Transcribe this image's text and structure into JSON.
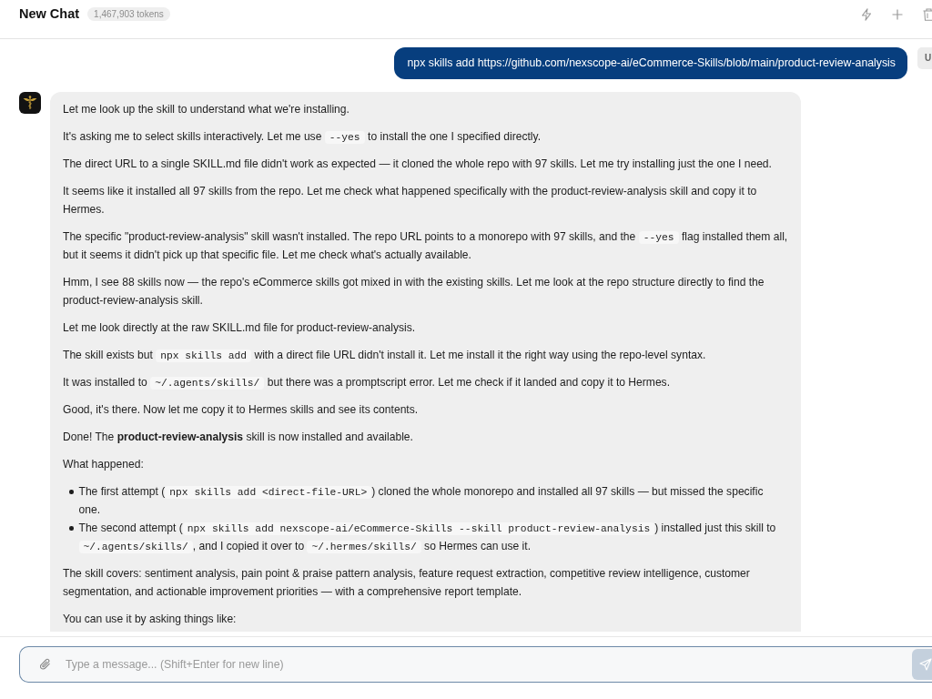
{
  "header": {
    "title": "New Chat",
    "token_count": "1,467,903 tokens"
  },
  "messages": [
    {
      "kind": "user",
      "avatar": "U",
      "text": "npx skills add https://github.com/nexscope-ai/eCommerce-Skills/blob/main/product-review-analysis"
    },
    {
      "kind": "assistant",
      "blocks": [
        {
          "kind": "para",
          "parts": [
            {
              "kind": "text",
              "text": "Let me look up the skill to understand what we're installing."
            }
          ]
        },
        {
          "kind": "para",
          "parts": [
            {
              "kind": "text",
              "text": "It's asking me to select skills interactively. Let me use "
            },
            {
              "kind": "code",
              "text": "--yes"
            },
            {
              "kind": "text",
              "text": " to install the one I specified directly."
            }
          ]
        },
        {
          "kind": "para",
          "parts": [
            {
              "kind": "text",
              "text": "The direct URL to a single SKILL.md file didn't work as expected — it cloned the whole repo with 97 skills. Let me try installing just the one I need."
            }
          ]
        },
        {
          "kind": "para",
          "parts": [
            {
              "kind": "text",
              "text": "It seems like it installed all 97 skills from the repo. Let me check what happened specifically with the product-review-analysis skill and copy it to Hermes."
            }
          ]
        },
        {
          "kind": "para",
          "parts": [
            {
              "kind": "text",
              "text": "The specific \"product-review-analysis\" skill wasn't installed. The repo URL points to a monorepo with 97 skills, and the "
            },
            {
              "kind": "code",
              "text": "--yes"
            },
            {
              "kind": "text",
              "text": " flag installed them all, but it seems it didn't pick up that specific file. Let me check what's actually available."
            }
          ]
        },
        {
          "kind": "para",
          "parts": [
            {
              "kind": "text",
              "text": "Hmm, I see 88 skills now — the repo's eCommerce skills got mixed in with the existing skills. Let me look at the repo structure directly to find the product-review-analysis skill."
            }
          ]
        },
        {
          "kind": "para",
          "parts": [
            {
              "kind": "text",
              "text": "Let me look directly at the raw SKILL.md file for product-review-analysis."
            }
          ]
        },
        {
          "kind": "para",
          "parts": [
            {
              "kind": "text",
              "text": "The skill exists but "
            },
            {
              "kind": "code",
              "text": "npx skills add"
            },
            {
              "kind": "text",
              "text": " with a direct file URL didn't install it. Let me install it the right way using the repo-level syntax."
            }
          ]
        },
        {
          "kind": "para",
          "parts": [
            {
              "kind": "text",
              "text": "It was installed to "
            },
            {
              "kind": "code",
              "text": "~/.agents/skills/"
            },
            {
              "kind": "text",
              "text": " but there was a promptscript error. Let me check if it landed and copy it to Hermes."
            }
          ]
        },
        {
          "kind": "para",
          "parts": [
            {
              "kind": "text",
              "text": "Good, it's there. Now let me copy it to Hermes skills and see its contents."
            }
          ]
        },
        {
          "kind": "para",
          "parts": [
            {
              "kind": "text",
              "text": "Done! The **product-review-analysis** skill is now installed and available."
            }
          ]
        },
        {
          "kind": "para",
          "parts": [
            {
              "kind": "text",
              "text": "What happened:"
            }
          ]
        },
        {
          "kind": "list",
          "items": [
            {
              "parts": [
                {
                  "kind": "text",
                  "text": "The first attempt ("
                },
                {
                  "kind": "code",
                  "text": "npx skills add <direct-file-URL>"
                },
                {
                  "kind": "text",
                  "text": ") cloned the whole monorepo and installed all 97 skills — but missed the specific one."
                }
              ]
            },
            {
              "parts": [
                {
                  "kind": "text",
                  "text": "The second attempt ("
                },
                {
                  "kind": "code",
                  "text": "npx skills add nexscope-ai/eCommerce-Skills --skill product-review-analysis"
                },
                {
                  "kind": "text",
                  "text": ") installed just this skill to "
                },
                {
                  "kind": "code",
                  "text": "~/.agents/skills/"
                },
                {
                  "kind": "text",
                  "text": ", and I copied it over to "
                },
                {
                  "kind": "code",
                  "text": "~/.hermes/skills/"
                },
                {
                  "kind": "text",
                  "text": " so Hermes can use it."
                }
              ]
            }
          ]
        },
        {
          "kind": "para",
          "parts": [
            {
              "kind": "text",
              "text": "The skill covers: sentiment analysis, pain point & praise pattern analysis, feature request extraction, competitive review intelligence, customer segmentation, and actionable improvement priorities — with a comprehensive report template."
            }
          ]
        },
        {
          "kind": "para",
          "parts": [
            {
              "kind": "text",
              "text": "You can use it by asking things like:"
            }
          ]
        }
      ]
    }
  ],
  "composer": {
    "placeholder": "Type a message... (Shift+Enter for new line)"
  }
}
